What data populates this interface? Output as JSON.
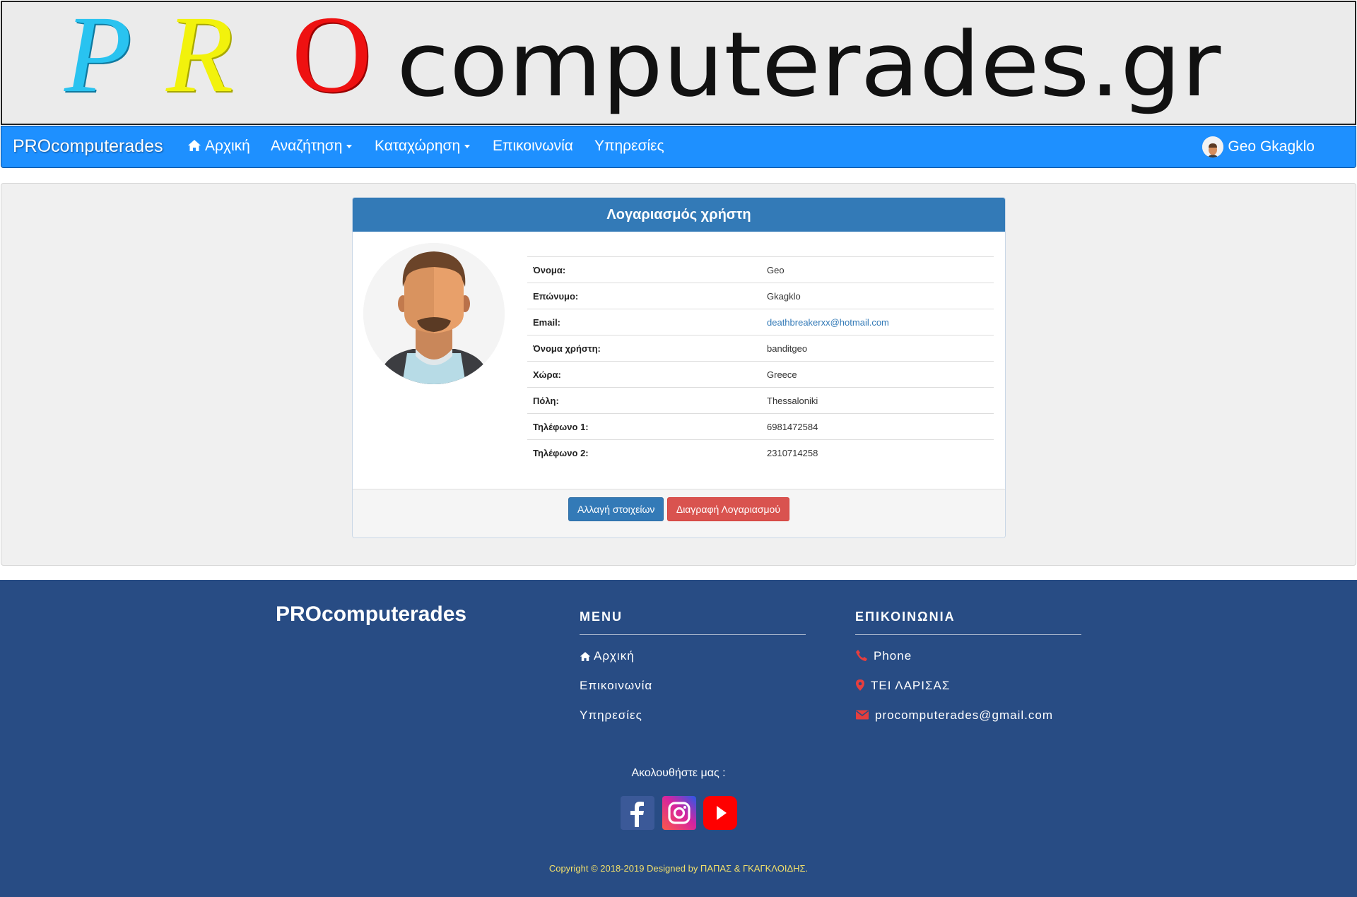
{
  "banner": {
    "letters": [
      "P",
      "R",
      "O"
    ],
    "domain": "computerades.gr"
  },
  "navbar": {
    "brand": "PROcomputerades",
    "items": [
      {
        "label": "Αρχική",
        "icon": "home-icon"
      },
      {
        "label": "Αναζήτηση",
        "dropdown": true
      },
      {
        "label": "Καταχώρηση",
        "dropdown": true
      },
      {
        "label": "Επικοινωνία"
      },
      {
        "label": "Υπηρεσίες"
      }
    ],
    "user": {
      "name": "Geo Gkagklo",
      "dropdown": true
    }
  },
  "account": {
    "title": "Λογαριασμός χρήστη",
    "rows": [
      {
        "label": "Όνομα:",
        "value": "Geo"
      },
      {
        "label": "Επώνυμο:",
        "value": "Gkagklo"
      },
      {
        "label": "Email:",
        "value": "deathbreakerxx@hotmail.com"
      },
      {
        "label": "Όνομα χρήστη:",
        "value": "banditgeo"
      },
      {
        "label": "Χώρα:",
        "value": "Greece"
      },
      {
        "label": "Πόλη:",
        "value": "Thessaloniki"
      },
      {
        "label": "Τηλέφωνο 1:",
        "value": "6981472584"
      },
      {
        "label": "Τηλέφωνο 2:",
        "value": "2310714258"
      }
    ],
    "edit_button": "Αλλαγή στοιχείων",
    "delete_button": "Διαγραφή Λογαριασμού"
  },
  "footer": {
    "brand": "PROcomputerades",
    "menu": {
      "title": "MENU",
      "items": [
        "Αρχική",
        "Επικοινωνία",
        "Υπηρεσίες"
      ]
    },
    "contact": {
      "title": "ΕΠΙΚΟΙΝΩΝΙΑ",
      "phone": "Phone",
      "address": "ΤΕΙ ΛΑΡΙΣΑΣ",
      "email": "procomputerades@gmail.com"
    },
    "follow": "Ακολουθήστε μας :",
    "social": [
      "facebook-icon",
      "instagram-icon",
      "youtube-icon"
    ],
    "copyright": "Copyright © 2018-2019 Designed by ΠΑΠΑΣ & ΓΚΑΓΚΛΟΙΔΗΣ."
  },
  "colors": {
    "navbar": "#1e90ff",
    "panel_heading": "#337ab7",
    "footer": "#284c84",
    "danger": "#d9534f",
    "accent_red": "#e53e3e"
  }
}
